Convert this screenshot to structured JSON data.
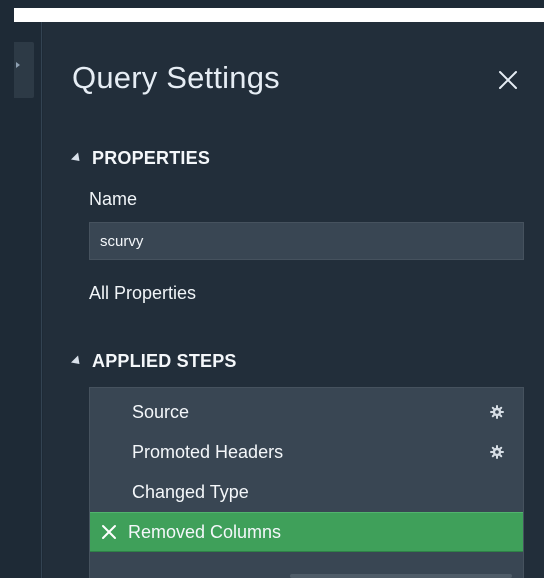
{
  "panel": {
    "title": "Query Settings",
    "close_icon": "close-icon"
  },
  "properties": {
    "header": "PROPERTIES",
    "name_label": "Name",
    "name_value": "scurvy",
    "all_properties_link": "All Properties"
  },
  "applied_steps": {
    "header": "APPLIED STEPS",
    "steps": [
      {
        "label": "Source",
        "has_gear": true,
        "selected": false
      },
      {
        "label": "Promoted Headers",
        "has_gear": true,
        "selected": false
      },
      {
        "label": "Changed Type",
        "has_gear": false,
        "selected": false
      },
      {
        "label": "Removed Columns",
        "has_gear": false,
        "selected": true
      }
    ]
  },
  "colors": {
    "background": "#222e3a",
    "field_bg": "#394653",
    "selected_step": "#3fa05a",
    "text": "#f4f7fa"
  }
}
